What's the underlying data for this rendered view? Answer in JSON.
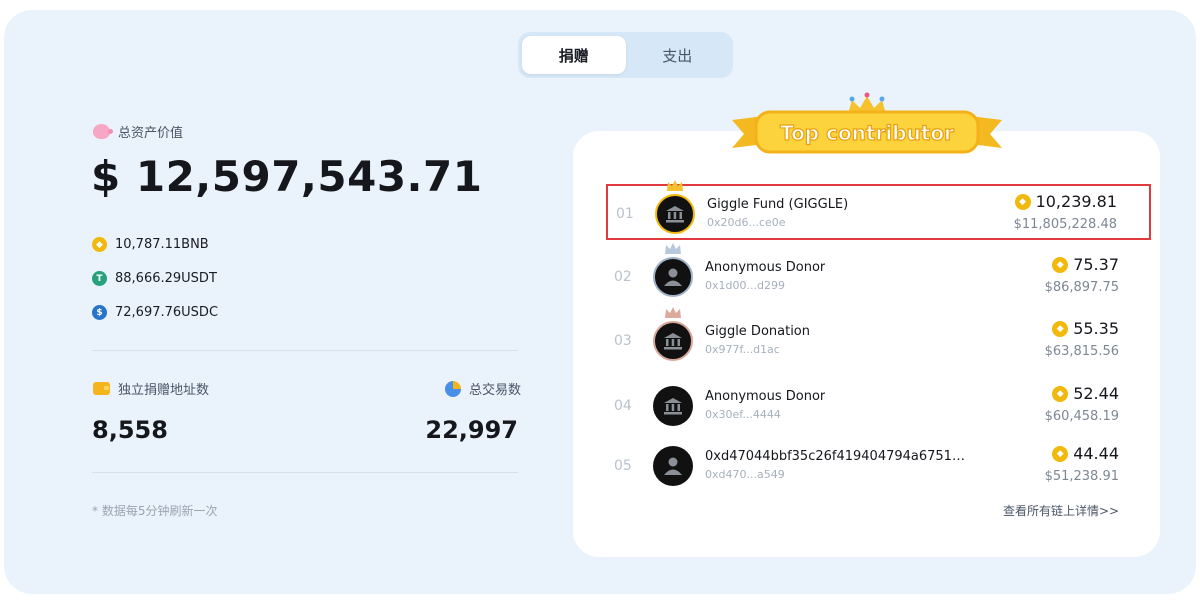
{
  "tabs": [
    {
      "label": "捐赠",
      "active": true
    },
    {
      "label": "支出",
      "active": false
    }
  ],
  "summary": {
    "total_label": "总资产价值",
    "total_value": "$ 12,597,543.71",
    "assets": [
      {
        "icon": "bnb-coin-icon",
        "text": "10,787.11BNB"
      },
      {
        "icon": "usdt-coin-icon",
        "text": "88,666.29USDT"
      },
      {
        "icon": "usdc-coin-icon",
        "text": "72,697.76USDC"
      }
    ],
    "donor_label": "独立捐赠地址数",
    "donor_value": "8,558",
    "tx_label": "总交易数",
    "tx_value": "22,997",
    "note": "* 数据每5分钟刷新一次"
  },
  "leaderboard": {
    "title": "Top contributor",
    "view_all": "查看所有链上详情>>",
    "rows": [
      {
        "rank": "01",
        "name": "Giggle Fund (GIGGLE)",
        "address": "0x20d6...ce0e",
        "amount": "10,239.81",
        "usd": "$11,805,228.48",
        "avatar": "bank-icon",
        "badge": "gold"
      },
      {
        "rank": "02",
        "name": "Anonymous Donor",
        "address": "0x1d00...d299",
        "amount": "75.37",
        "usd": "$86,897.75",
        "avatar": "person-icon",
        "badge": "silver"
      },
      {
        "rank": "03",
        "name": "Giggle Donation",
        "address": "0x977f...d1ac",
        "amount": "55.35",
        "usd": "$63,815.56",
        "avatar": "bank-icon",
        "badge": "bronze"
      },
      {
        "rank": "04",
        "name": "Anonymous Donor",
        "address": "0x30ef...4444",
        "amount": "52.44",
        "usd": "$60,458.19",
        "avatar": "bank-icon",
        "badge": "none"
      },
      {
        "rank": "05",
        "name": "0xd47044bbf35c26f419404794a67516a7c5…",
        "address": "0xd470...a549",
        "amount": "44.44",
        "usd": "$51,238.91",
        "avatar": "person-icon",
        "badge": "none"
      }
    ]
  },
  "colors": {
    "background": "#eaf3fb",
    "bnb": "#f0b90b",
    "highlight": "#e0393e"
  }
}
